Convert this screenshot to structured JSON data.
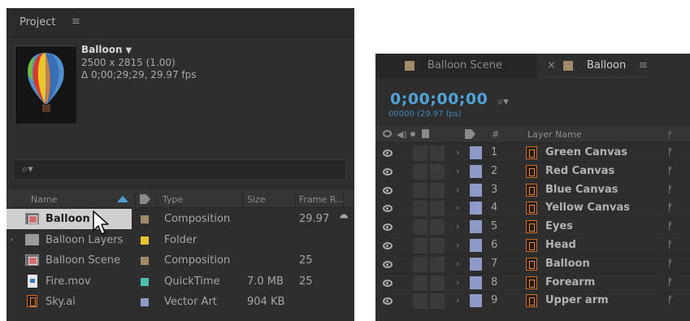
{
  "project_panel": {
    "title": "Project",
    "menu_glyph": "≡",
    "comp_name": "Balloon",
    "dropdown_glyph": "▼",
    "dimensions": "2500 x 2815 (1.00)",
    "duration": "Δ 0;00;29;29, 29.97 fps",
    "search_glyph": "⌕▾",
    "columns": {
      "name": "Name",
      "type": "Type",
      "size": "Size",
      "frame_rate": "Frame R..."
    },
    "flowchart_glyph": "⯊",
    "items": [
      {
        "name": "Balloon",
        "type": "Composition",
        "size": "",
        "frame_rate": "29.97",
        "icon": "composition-icon",
        "label_color": "#a08a6a",
        "selected": true,
        "expandable": false
      },
      {
        "name": "Balloon Layers",
        "type": "Folder",
        "size": "",
        "frame_rate": "",
        "icon": "folder-icon",
        "label_color": "#e6c62a",
        "selected": false,
        "expandable": true
      },
      {
        "name": "Balloon Scene",
        "type": "Composition",
        "size": "",
        "frame_rate": "25",
        "icon": "composition-icon",
        "label_color": "#a08a6a",
        "selected": false,
        "expandable": false
      },
      {
        "name": "Fire.mov",
        "type": "QuickTime",
        "size": "7.0 MB",
        "frame_rate": "25",
        "icon": "movie-file-icon",
        "label_color": "#4fbfb0",
        "selected": false,
        "expandable": false
      },
      {
        "name": "Sky.ai",
        "type": "Vector Art",
        "size": "904 KB",
        "frame_rate": "",
        "icon": "illustrator-file-icon",
        "label_color": "#8e9ac8",
        "selected": false,
        "expandable": false
      }
    ]
  },
  "timeline_panel": {
    "tabs": [
      {
        "label": "Balloon Scene",
        "close_glyph": "",
        "menu_glyph": "",
        "active": false
      },
      {
        "label": "Balloon",
        "close_glyph": "×",
        "menu_glyph": "≡",
        "active": true
      }
    ],
    "timecode": "0;00;00;00",
    "frame_info": "00000 (29.97 fps)",
    "search_glyph": "⌕▾",
    "columns": {
      "number": "#",
      "layer_name": "Layer Name"
    },
    "header_speaker_glyph": "◀)",
    "pick_glyph": "ᚠ",
    "expand_glyph": "›",
    "layers": [
      {
        "number": "1",
        "name": "Green Canvas"
      },
      {
        "number": "2",
        "name": "Red Canvas"
      },
      {
        "number": "3",
        "name": "Blue Canvas"
      },
      {
        "number": "4",
        "name": "Yellow Canvas"
      },
      {
        "number": "5",
        "name": "Eyes"
      },
      {
        "number": "6",
        "name": "Head"
      },
      {
        "number": "7",
        "name": "Balloon"
      },
      {
        "number": "8",
        "name": "Forearm"
      },
      {
        "number": "9",
        "name": "Upper arm"
      }
    ]
  },
  "colors": {
    "panel_bg": "#2e2e2e",
    "accent_blue": "#4fa3d9",
    "selection_bg": "#cfcfcf",
    "layer_label": "#8e9ac8"
  }
}
